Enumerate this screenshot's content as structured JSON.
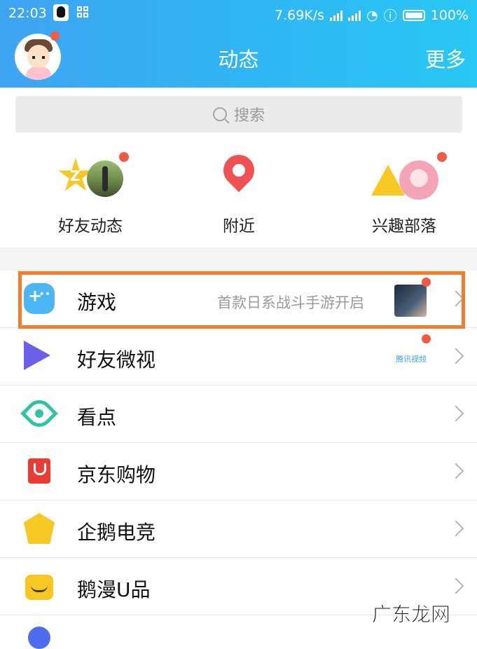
{
  "status_bar": {
    "time": "22:03",
    "network_speed": "7.69K/s",
    "battery_percent": "100%"
  },
  "header": {
    "title": "动态",
    "more_label": "更多"
  },
  "search": {
    "placeholder": "搜索"
  },
  "quick_actions": [
    {
      "label": "好友动态"
    },
    {
      "label": "附近"
    },
    {
      "label": "兴趣部落"
    }
  ],
  "list_items": [
    {
      "label": "游戏",
      "subtitle": "首款日系战斗手游开启"
    },
    {
      "label": "好友微视",
      "badge_text": "腾讯视频"
    },
    {
      "label": "看点"
    },
    {
      "label": "京东购物"
    },
    {
      "label": "企鹅电竞"
    },
    {
      "label": "鹅漫U品"
    }
  ],
  "watermark": "广东龙网",
  "colors": {
    "header_start": "#3ea4f2",
    "header_end": "#29c7f3",
    "notification_dot": "#f25a43",
    "highlight_border": "#f57c2a"
  }
}
